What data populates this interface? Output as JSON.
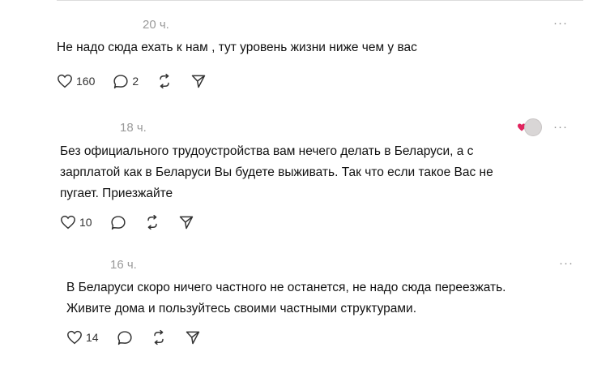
{
  "posts": [
    {
      "time": "20 ч.",
      "text": "Не надо сюда ехать к нам , тут уровень жизни ниже чем у вас",
      "likes": "160",
      "replies": "2",
      "more": "···"
    },
    {
      "time": "18 ч.",
      "text": "Без официального трудоустройства вам нечего делать в Беларуси, а с\nзарплатой как в Беларуси Вы будете выживать. Так что если такое Вас не\nпугает. Приезжайте",
      "likes": "10",
      "replies": "",
      "more": "···"
    },
    {
      "time": "16 ч.",
      "text": "В Беларуси скоро ничего частного не останется, не надо сюда переезжать.\nЖивите дома и пользуйтесь своими частными структурами.",
      "likes": "14",
      "replies": "",
      "more": "···"
    }
  ],
  "colors": {
    "heart_badge": "#e0245e",
    "icon_stroke": "#333333",
    "time": "#9a9a9a"
  }
}
